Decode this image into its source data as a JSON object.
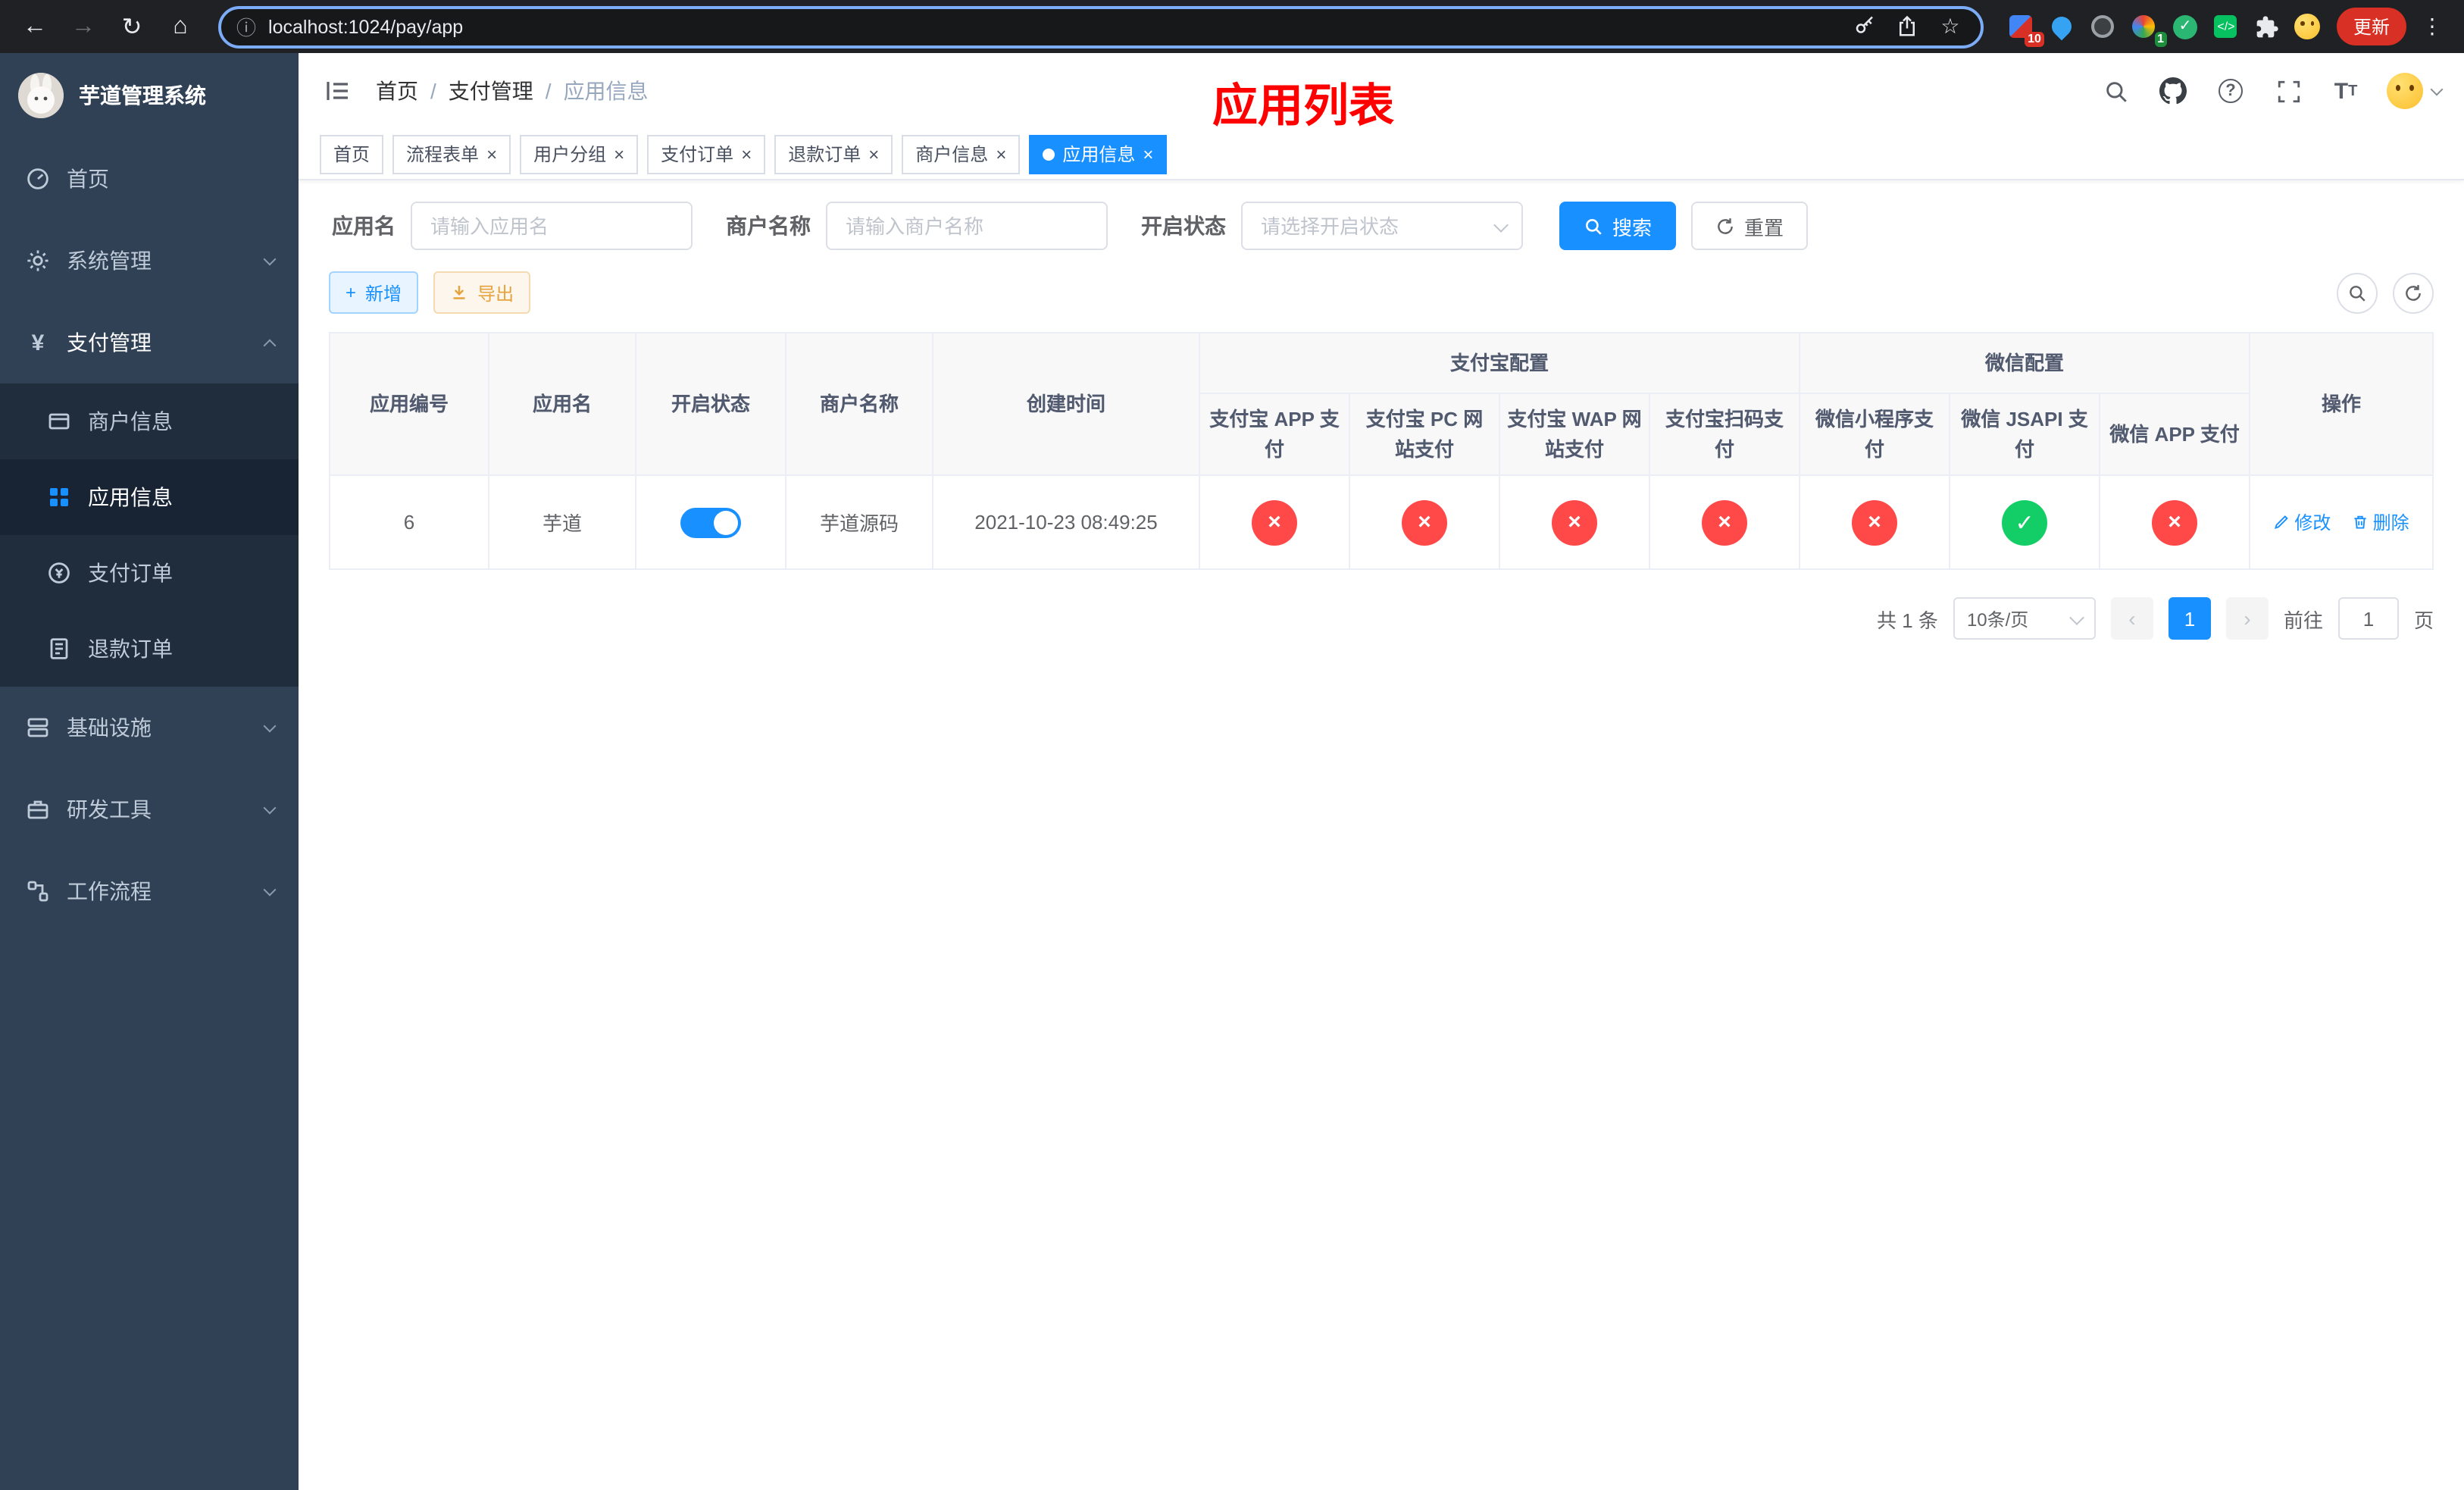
{
  "browser": {
    "url": "localhost:1024/pay/app",
    "update_button": "更新",
    "ext_badge_1": "10",
    "ext_badge_2": "1"
  },
  "icons": {
    "back": "←",
    "forward": "→",
    "reload": "↻",
    "home": "⌂",
    "info": "ⓘ",
    "star": "☆",
    "kebab": "⋮",
    "prev": "‹",
    "next": "›",
    "plus": "+",
    "close": "×",
    "check": "✓"
  },
  "sidebar": {
    "title": "芋道管理系统",
    "items": [
      {
        "label": "首页"
      },
      {
        "label": "系统管理"
      },
      {
        "label": "支付管理"
      },
      {
        "label": "基础设施"
      },
      {
        "label": "研发工具"
      },
      {
        "label": "工作流程"
      }
    ],
    "submenu": [
      {
        "label": "商户信息"
      },
      {
        "label": "应用信息"
      },
      {
        "label": "支付订单"
      },
      {
        "label": "退款订单"
      }
    ]
  },
  "breadcrumb": [
    "首页",
    "支付管理",
    "应用信息"
  ],
  "annotation": {
    "title": "应用列表"
  },
  "tabs": [
    {
      "label": "首页"
    },
    {
      "label": "流程表单"
    },
    {
      "label": "用户分组"
    },
    {
      "label": "支付订单"
    },
    {
      "label": "退款订单"
    },
    {
      "label": "商户信息"
    },
    {
      "label": "应用信息"
    }
  ],
  "filters": {
    "app_name_label": "应用名",
    "app_name_placeholder": "请输入应用名",
    "merchant_label": "商户名称",
    "merchant_placeholder": "请输入商户名称",
    "status_label": "开启状态",
    "status_placeholder": "请选择开启状态",
    "search_button": "搜索",
    "reset_button": "重置"
  },
  "toolbar": {
    "add_button": "新增",
    "export_button": "导出"
  },
  "table": {
    "headers": {
      "app_id": "应用编号",
      "app_name": "应用名",
      "status": "开启状态",
      "merchant": "商户名称",
      "created": "创建时间",
      "alipay_group": "支付宝配置",
      "wechat_group": "微信配置",
      "alipay_app": "支付宝 APP 支付",
      "alipay_pc": "支付宝 PC 网站支付",
      "alipay_wap": "支付宝 WAP 网站支付",
      "alipay_qr": "支付宝扫码支付",
      "wx_mini": "微信小程序支付",
      "wx_jsapi": "微信 JSAPI 支付",
      "wx_app": "微信 APP 支付",
      "actions": "操作"
    },
    "rows": [
      {
        "app_id": "6",
        "app_name": "芋道",
        "status": "on",
        "merchant": "芋道源码",
        "created": "2021-10-23 08:49:25",
        "alipay_app": "disabled",
        "alipay_pc": "disabled",
        "alipay_wap": "disabled",
        "alipay_qr": "disabled",
        "wx_mini": "disabled",
        "wx_jsapi": "enabled",
        "wx_app": "disabled",
        "edit_label": "修改",
        "delete_label": "删除"
      }
    ]
  },
  "pagination": {
    "total": "共 1 条",
    "page_size": "10条/页",
    "current_page": "1",
    "goto_label": "前往",
    "goto_value": "1",
    "page_unit": "页"
  },
  "colors": {
    "accent": "#1890ff",
    "danger": "#ff4949",
    "success": "#13ce66",
    "sidebar_bg": "#304156",
    "annotation_red": "#ff0000"
  }
}
